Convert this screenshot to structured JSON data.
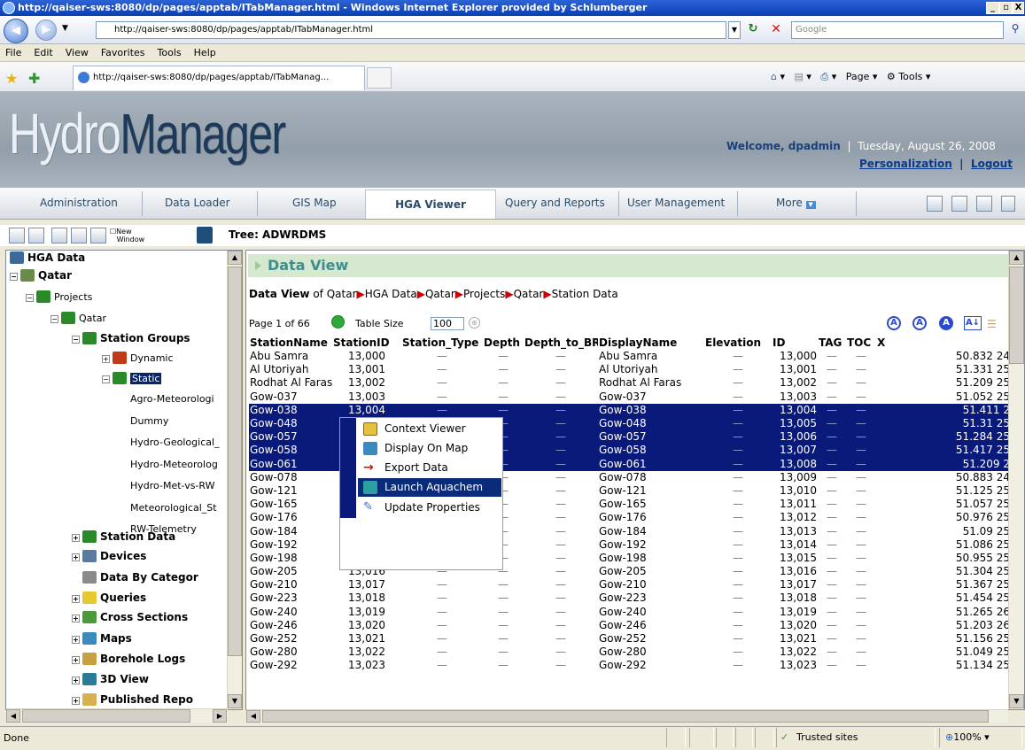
{
  "window": {
    "title": "http://qaiser-sws:8080/dp/pages/apptab/ITabManager.html - Windows Internet Explorer provided by Schlumberger",
    "address": "http://qaiser-sws:8080/dp/pages/apptab/ITabManager.html",
    "search_placeholder": "Google",
    "tab_title": "http://qaiser-sws:8080/dp/pages/apptab/ITabManag...",
    "minimize": "_",
    "maximize": "▫",
    "close": "X"
  },
  "menu": [
    "File",
    "Edit",
    "View",
    "Favorites",
    "Tools",
    "Help"
  ],
  "commands": {
    "page": "Page",
    "tools": "Tools"
  },
  "app": {
    "logo_a": "Hydro",
    "logo_b": "Manager",
    "welcome": "Welcome, dpadmin",
    "date": "Tuesday, August 26, 2008",
    "personalization": "Personalization",
    "logout": "Logout"
  },
  "nav": [
    "Administration",
    "Data Loader",
    "GIS Map",
    "HGA Viewer",
    "Query and Reports",
    "User Management",
    "More"
  ],
  "toolbar": {
    "new_window_1": "New",
    "new_window_2": "Window",
    "tree_title": "Tree: ADWRDMS"
  },
  "tree": {
    "hga_data": "HGA Data",
    "qatar": "Qatar",
    "projects": "Projects",
    "qatar2": "Qatar",
    "station_groups": "Station Groups",
    "dynamic": "Dynamic",
    "static": "Static",
    "leaves": [
      "Agro-Meteorologi",
      "Dummy",
      "Hydro-Geological_",
      "Hydro-Meteorolog",
      "Hydro-Met-vs-RW",
      "Meteorological_St",
      "RW-Telemetry"
    ],
    "bottom": [
      "Station Data",
      "Devices",
      "Data By Categor",
      "Queries",
      "Cross Sections",
      "Maps",
      "Borehole Logs",
      "3D View",
      "Published Repo"
    ]
  },
  "dataview": {
    "header": "Data View",
    "crumb_label": "Data View",
    "crumb_of": "of",
    "crumbs": [
      "Qatar",
      "HGA Data",
      "Qatar",
      "Projects",
      "Qatar",
      "Station Data"
    ],
    "page": "Page 1 of 66",
    "table_size_label": "Table Size",
    "table_size": "100",
    "sort_az": "A↓"
  },
  "grid": {
    "columns": [
      "StationName",
      "StationID",
      "Station_Type",
      "Depth",
      "Depth_to_BR",
      "DisplayName",
      "Elevation",
      "ID",
      "TAG",
      "TOC",
      "X"
    ],
    "rows": [
      [
        "Abu Samra",
        "13,000",
        "—",
        "—",
        "—",
        "Abu Samra",
        "—",
        "13,000",
        "—",
        "—",
        "50.832 24"
      ],
      [
        "Al Utoriyah",
        "13,001",
        "—",
        "—",
        "—",
        "Al Utoriyah",
        "—",
        "13,001",
        "—",
        "—",
        "51.331 25"
      ],
      [
        "Rodhat Al Faras",
        "13,002",
        "—",
        "—",
        "—",
        "Rodhat Al Faras",
        "—",
        "13,002",
        "—",
        "—",
        "51.209 25"
      ],
      [
        "Gow-037",
        "13,003",
        "—",
        "—",
        "—",
        "Gow-037",
        "—",
        "13,003",
        "—",
        "—",
        "51.052 25"
      ],
      [
        "Gow-038",
        "13,004",
        "—",
        "—",
        "—",
        "Gow-038",
        "—",
        "13,004",
        "—",
        "—",
        "51.411  2"
      ],
      [
        "Gow-048",
        "",
        "—",
        "—",
        "—",
        "Gow-048",
        "—",
        "13,005",
        "—",
        "—",
        "51.31 25"
      ],
      [
        "Gow-057",
        "",
        "—",
        "—",
        "—",
        "Gow-057",
        "—",
        "13,006",
        "—",
        "—",
        "51.284 25"
      ],
      [
        "Gow-058",
        "",
        "—",
        "—",
        "—",
        "Gow-058",
        "—",
        "13,007",
        "—",
        "—",
        "51.417 25"
      ],
      [
        "Gow-061",
        "",
        "—",
        "—",
        "—",
        "Gow-061",
        "—",
        "13,008",
        "—",
        "—",
        "51.209  2"
      ],
      [
        "Gow-078",
        "",
        "—",
        "—",
        "—",
        "Gow-078",
        "—",
        "13,009",
        "—",
        "—",
        "50.883 24"
      ],
      [
        "Gow-121",
        "",
        "—",
        "—",
        "—",
        "Gow-121",
        "—",
        "13,010",
        "—",
        "—",
        "51.125 25"
      ],
      [
        "Gow-165",
        "",
        "—",
        "—",
        "—",
        "Gow-165",
        "—",
        "13,011",
        "—",
        "—",
        "51.057 25"
      ],
      [
        "Gow-176",
        "",
        "—",
        "—",
        "—",
        "Gow-176",
        "—",
        "13,012",
        "—",
        "—",
        "50.976 25"
      ],
      [
        "Gow-184",
        "",
        "—",
        "—",
        "—",
        "Gow-184",
        "—",
        "13,013",
        "—",
        "—",
        "51.09 25"
      ],
      [
        "Gow-192",
        "",
        "—",
        "—",
        "—",
        "Gow-192",
        "—",
        "13,014",
        "—",
        "—",
        "51.086 25"
      ],
      [
        "Gow-198",
        "13,015",
        "—",
        "—",
        "—",
        "Gow-198",
        "—",
        "13,015",
        "—",
        "—",
        "50.955 25"
      ],
      [
        "Gow-205",
        "13,016",
        "—",
        "—",
        "—",
        "Gow-205",
        "—",
        "13,016",
        "—",
        "—",
        "51.304 25"
      ],
      [
        "Gow-210",
        "13,017",
        "—",
        "—",
        "—",
        "Gow-210",
        "—",
        "13,017",
        "—",
        "—",
        "51.367 25"
      ],
      [
        "Gow-223",
        "13,018",
        "—",
        "—",
        "—",
        "Gow-223",
        "—",
        "13,018",
        "—",
        "—",
        "51.454 25"
      ],
      [
        "Gow-240",
        "13,019",
        "—",
        "—",
        "—",
        "Gow-240",
        "—",
        "13,019",
        "—",
        "—",
        "51.265 26"
      ],
      [
        "Gow-246",
        "13,020",
        "—",
        "—",
        "—",
        "Gow-246",
        "—",
        "13,020",
        "—",
        "—",
        "51.203 26"
      ],
      [
        "Gow-252",
        "13,021",
        "—",
        "—",
        "—",
        "Gow-252",
        "—",
        "13,021",
        "—",
        "—",
        "51.156 25"
      ],
      [
        "Gow-280",
        "13,022",
        "—",
        "—",
        "—",
        "Gow-280",
        "—",
        "13,022",
        "—",
        "—",
        "51.049 25"
      ],
      [
        "Gow-292",
        "13,023",
        "—",
        "—",
        "—",
        "Gow-292",
        "—",
        "13,023",
        "—",
        "—",
        "51.134 25"
      ]
    ],
    "selected_rows": [
      4,
      5,
      6,
      7,
      8
    ]
  },
  "context_menu": [
    "Context Viewer",
    "Display On Map",
    "Export Data",
    "Launch Aquachem",
    "Update Properties"
  ],
  "status": {
    "left": "Done",
    "zone": "Trusted sites",
    "zoom": "100%"
  }
}
